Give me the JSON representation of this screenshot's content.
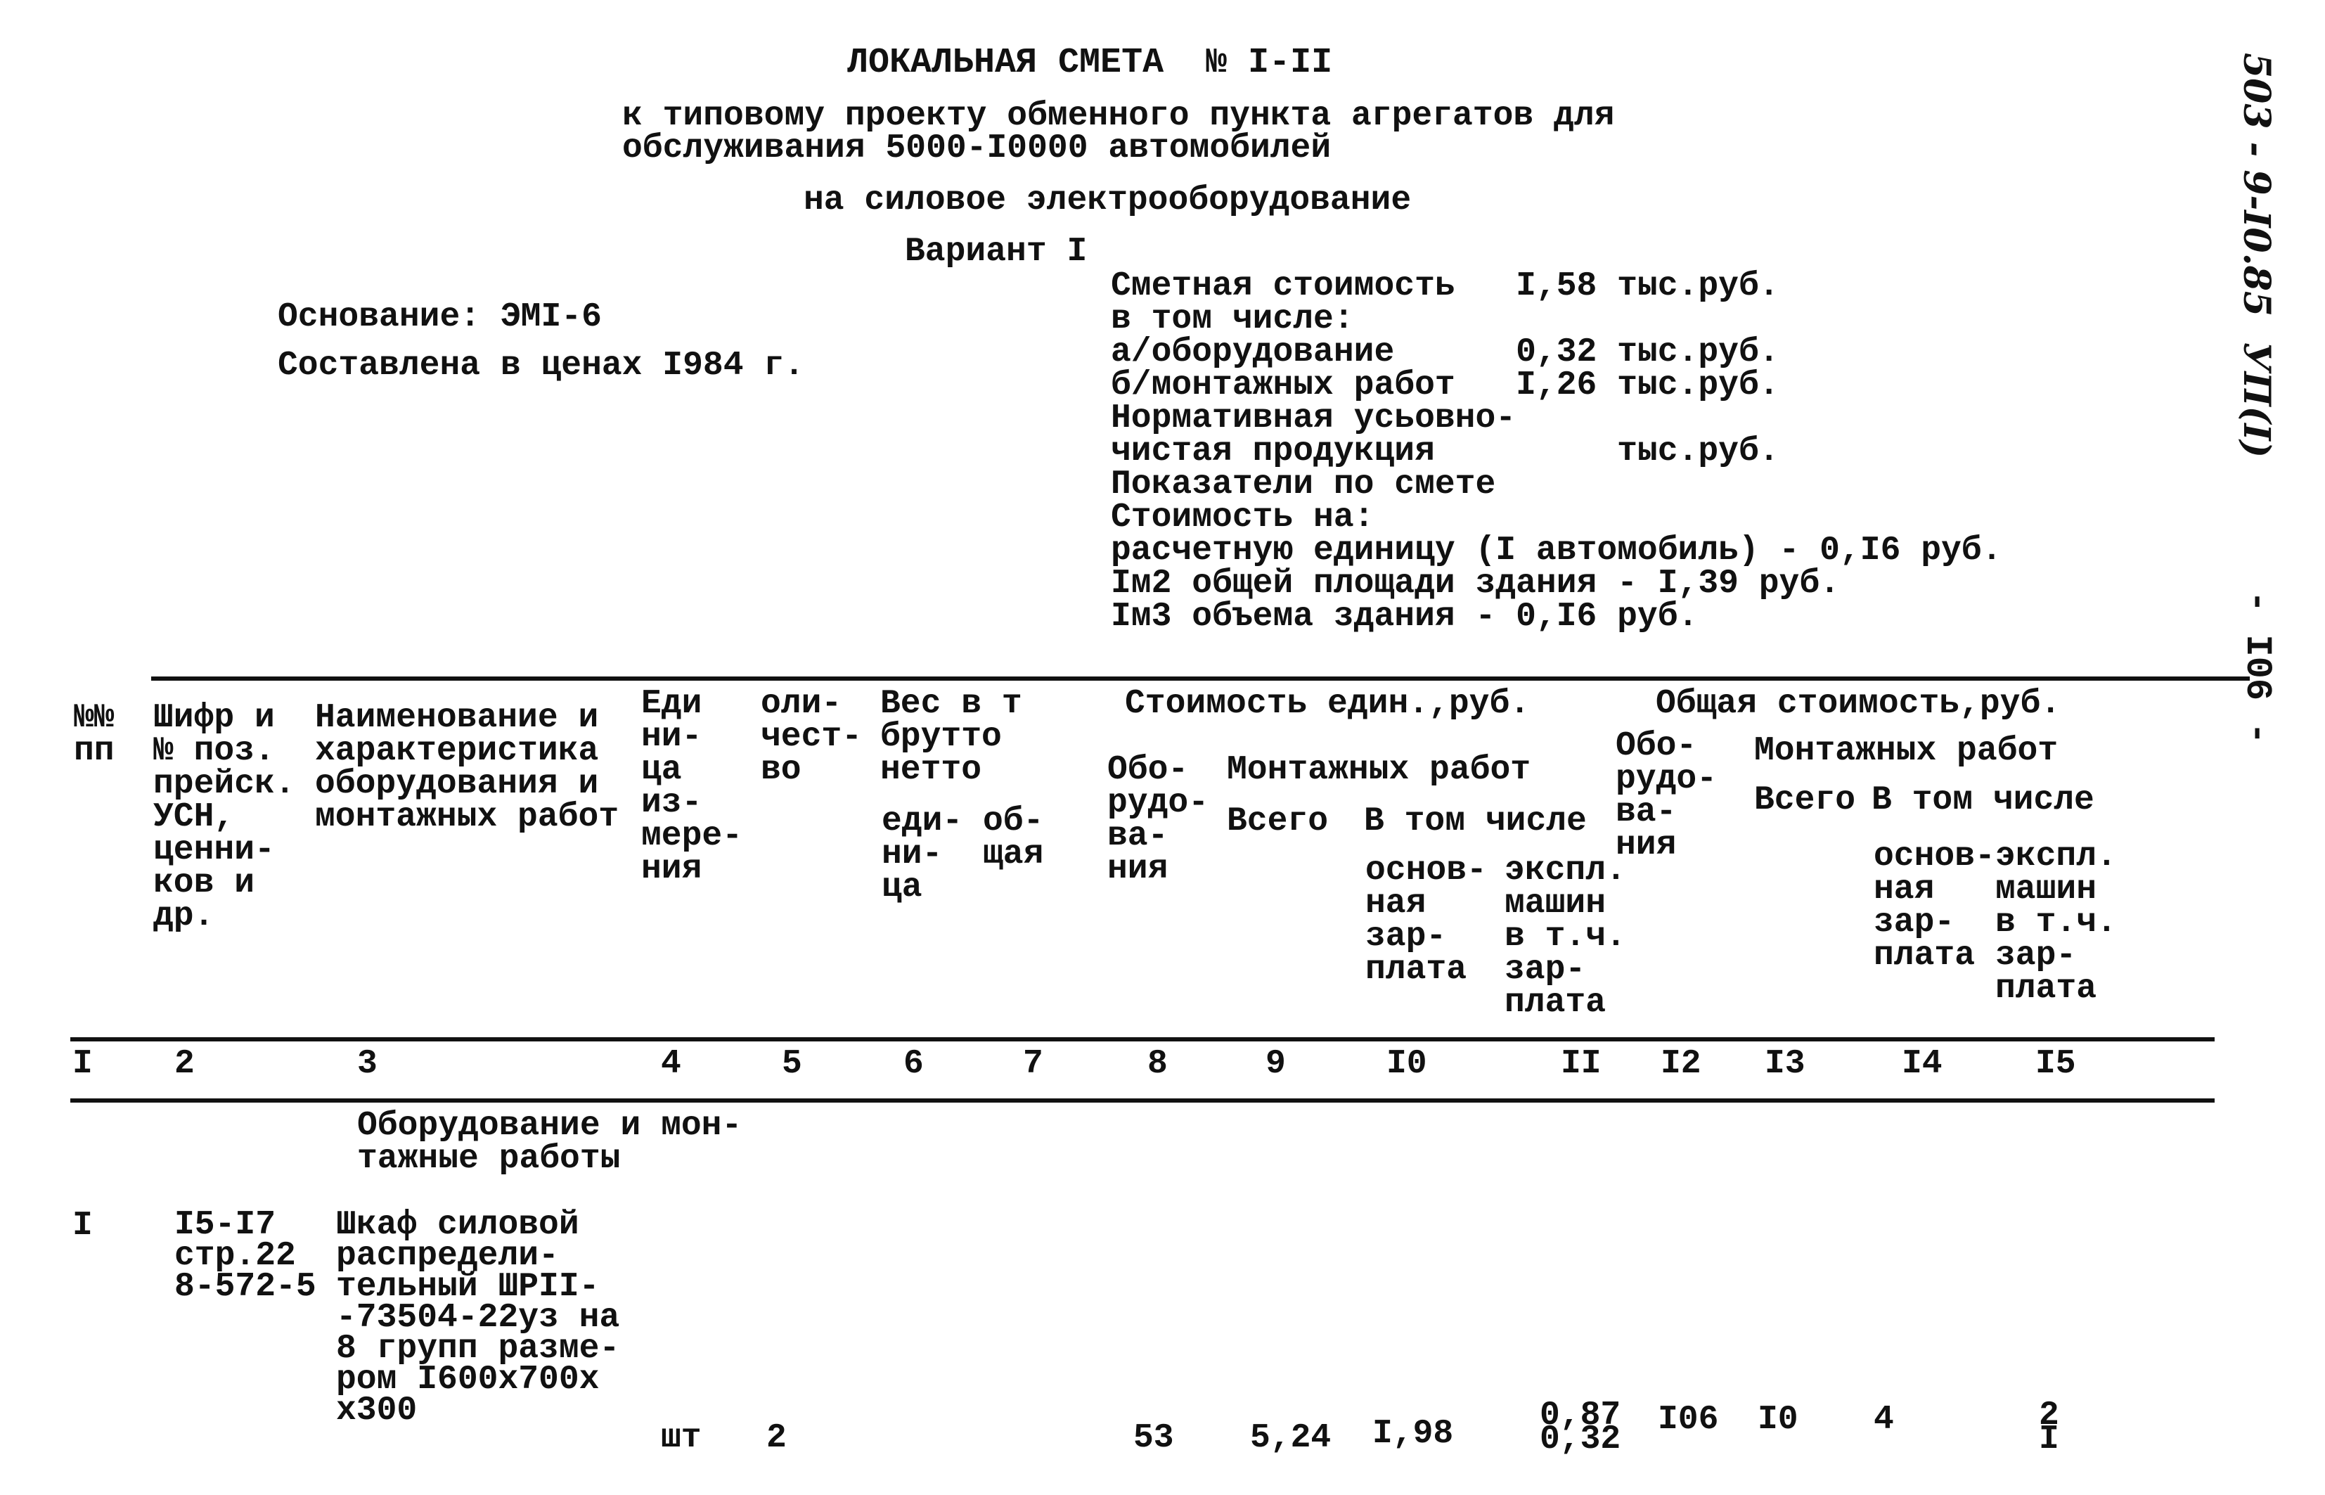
{
  "header": {
    "title": "ЛОКАЛЬНАЯ СМЕТА  № I-II",
    "subtitle_line1": "к типовому проекту обменного пункта агрегатов для",
    "subtitle_line2": "обслуживания 5000-I0000 автомобилей",
    "subject": "на силовое электрооборудование",
    "variant": "Вариант I"
  },
  "basis": {
    "basis_line": "Основание: ЭМI-6",
    "prices_line": "Составлена в ценах I984 г."
  },
  "summary": {
    "lines": [
      "Сметная стоимость   I,58 тыс.руб.",
      "в том числе:",
      "а/оборудование      0,32 тыс.руб.",
      "б/монтажных работ   I,26 тыс.руб.",
      "Нормативная усьовно-",
      "чистая продукция         тыс.руб.",
      "Показатели по смете",
      "Стоимость на:",
      "расчетную единицу (I автомобиль) - 0,I6 руб.",
      "Iм2 общей площади здания - I,39 руб.",
      "Iм3 объема здания - 0,I6 руб."
    ]
  },
  "margin": {
    "doc_code": "503 - 9-I0.85  УП(I)",
    "page_number": "- I06 -"
  },
  "table": {
    "headers": {
      "c1": "№№\nпп",
      "c2": "Шифр и\n№ поз.\nпрейск.\nУСН,\nценни-\nков и\nдр.",
      "c3": "Наименование и\nхарактеристика\nоборудования и\nмонтажных работ",
      "c4": "Еди\nни-\nца\nиз-\nмере-\nния",
      "c5": "оли-\nчест-\nво",
      "c6_7_group": "Вес в т\nбрутто\nнетто",
      "c6": "еди-\nни-\nца",
      "c7": "об-\nщая",
      "unit_cost_group": "Стоимость един.,руб.",
      "c8": "Обо-\nрудо-\nва-\nния",
      "unit_install_group": "Монтажных работ",
      "c9": "Всего",
      "unit_incl_group": "В том числе",
      "c10": "основ-\nная\nзар-\nплата",
      "c11": "экспл.\nмашин\nв т.ч.\nзар-\nплата",
      "total_cost_group": "Общая стоимость,руб.",
      "c12": "Обо-\nрудо-\nва-\nния",
      "total_install_group": "Монтажных работ",
      "c13": "Всего",
      "total_incl_group": "В том числе",
      "c14": "основ-\nная\nзар-\nплата",
      "c15": "экспл.\nмашин\nв т.ч.\nзар-\nплата"
    },
    "column_numbers": [
      "I",
      "2",
      "3",
      "4",
      "5",
      "6",
      "7",
      "8",
      "9",
      "I0",
      "II",
      "I2",
      "I3",
      "I4",
      "I5"
    ],
    "section_title": "Оборудование и мон-\nтажные работы",
    "rows": [
      {
        "num": "I",
        "code": "I5-I7\nстр.22\n8-572-5",
        "name": "Шкаф силовой\nраспредели-\nтельный ШРII-\n-73504-22уз на\n8 групп разме-\nром I600х700х\nх300",
        "unit": "шт",
        "qty": "2",
        "weight_unit": "",
        "weight_total": "",
        "unit_equipment": "53",
        "unit_install_total": "5,24",
        "unit_install_wage": "I,98",
        "unit_install_machines": "0,87",
        "unit_install_machines_wage": "0,32",
        "total_equipment": "I06",
        "total_install_total": "I0",
        "total_install_wage": "4",
        "total_install_machines": "2",
        "total_install_machines_wage": "I"
      }
    ]
  }
}
